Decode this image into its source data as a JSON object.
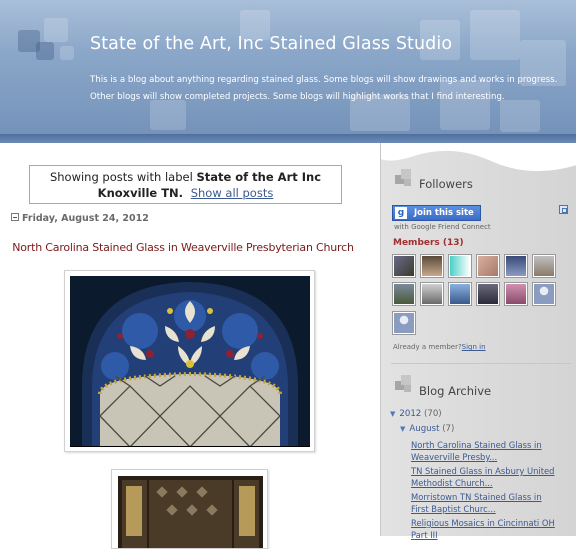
{
  "header": {
    "title": "State of the Art, Inc Stained Glass Studio",
    "description": "This is a blog about anything regarding stained glass. Some blogs will show drawings and works in progress. Other blogs will show completed projects. Some blogs will highlight works that I find interesting."
  },
  "main": {
    "label_prefix": "Showing posts with label",
    "label_name": "State of the Art Inc Knoxville TN.",
    "show_all": "Show all posts",
    "date": "Friday, August 24, 2012",
    "post_title": "North Carolina Stained Glass in Weaverville Presbyterian Church"
  },
  "sidebar": {
    "followers": {
      "title": "Followers",
      "join_label": "Join this site",
      "gfc_text": "with Google Friend Connect",
      "members_label": "Members (13)",
      "already_text": "Already a member?",
      "sign_in": "Sign in"
    },
    "archive": {
      "title": "Blog Archive",
      "year": "2012",
      "year_count": "(70)",
      "month": "August",
      "month_count": "(7)",
      "posts": [
        "North Carolina Stained Glass in Weaverville Presby...",
        "TN Stained Glass in Asbury United Methodist Church...",
        "Morristown TN Stained Glass in First Baptist Churc...",
        "Religious Mosaics in Cincinnati OH Part III"
      ]
    }
  },
  "icons": {
    "collapse": "collapse-minus-icon",
    "widget": "widget-squares-icon",
    "google": "google-g-icon",
    "expand_arrow": "triangle-down-icon",
    "external": "popout-icon"
  },
  "colors": {
    "header_bg": "#8aa6c8",
    "link": "#3b5a92",
    "post_title": "#7a1a1a",
    "members": "#a03030",
    "join_button": "#3b6dc6"
  }
}
